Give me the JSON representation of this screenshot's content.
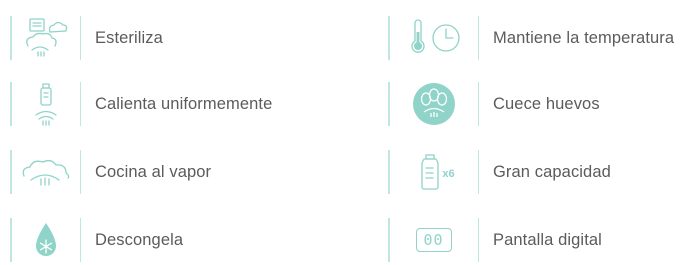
{
  "accent": "#8fd3c9",
  "text_color": "#5b5b5b",
  "features": {
    "left": [
      {
        "label": "Esteriliza",
        "icon": "sterilize-icon"
      },
      {
        "label": "Calienta uniformemente",
        "icon": "bottle-warm-icon"
      },
      {
        "label": "Cocina al vapor",
        "icon": "steam-cloud-icon"
      },
      {
        "label": "Descongela",
        "icon": "snowflake-drop-icon"
      }
    ],
    "right": [
      {
        "label": "Mantiene la temperatura",
        "icon": "thermometer-clock-icon"
      },
      {
        "label": "Cuece huevos",
        "icon": "eggs-icon"
      },
      {
        "label": "Gran capacidad",
        "icon": "bottle-x6-icon",
        "badge": "x6"
      },
      {
        "label": "Pantalla digital",
        "icon": "digital-display-icon",
        "display": "00"
      }
    ]
  }
}
